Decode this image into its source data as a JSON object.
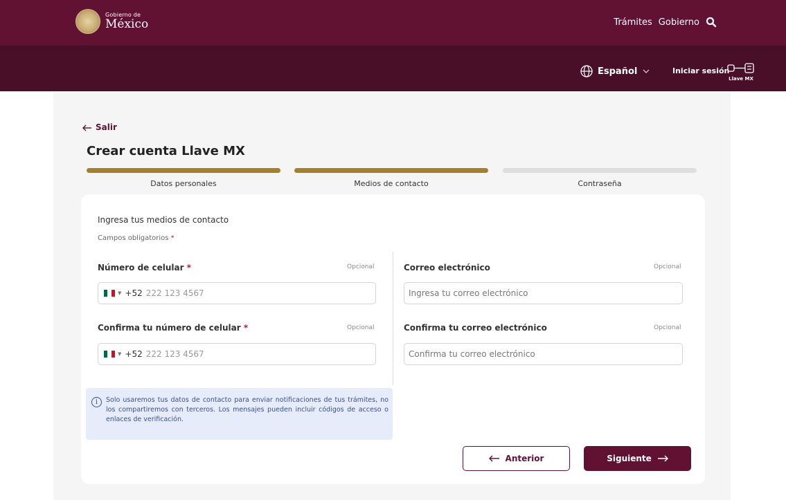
{
  "header": {
    "logo_small": "Gobierno de",
    "logo_big": "México",
    "nav": [
      "Trámites",
      "Gobierno"
    ],
    "language": "Español",
    "login": "Iniciar sesión",
    "llave_label": "Llave MX"
  },
  "page": {
    "back_label": "Salir",
    "title": "Crear cuenta Llave MX"
  },
  "stepper": {
    "steps": [
      {
        "label": "Datos personales",
        "state": "complete"
      },
      {
        "label": "Medios de contacto",
        "state": "current"
      },
      {
        "label": "Contraseña",
        "state": "pending"
      }
    ]
  },
  "form": {
    "intro": "Ingresa tus medios de contacto",
    "required_note": "Campos obligatorios",
    "required_marker": "*",
    "optional_label": "Opcional",
    "phone": {
      "label": "Número de celular",
      "dial_code": "+52",
      "placeholder": "222 123 4567"
    },
    "phone_confirm": {
      "label": "Confirma tu número de celular",
      "dial_code": "+52",
      "placeholder": "222 123 4567"
    },
    "email": {
      "label": "Correo electrónico",
      "placeholder": "Ingresa tu correo electrónico"
    },
    "email_confirm": {
      "label": "Confirma tu correo electrónico",
      "placeholder": "Confirma tu correo electrónico"
    },
    "info": "Solo usaremos tus datos de contacto para enviar notificaciones de tus trámites, no los compartiremos con terceros. Los mensajes pueden incluir códigos de acceso o enlaces de verificación."
  },
  "buttons": {
    "previous": "Anterior",
    "next": "Siguiente"
  },
  "colors": {
    "primary": "#611232",
    "secondary_bar": "#4a0f28",
    "gold": "#a57f2c",
    "step_pending": "#dedede",
    "info_bg": "#e7ecfa",
    "info_text": "#3a4f8f",
    "required": "#9f2241"
  },
  "icons": {
    "seal": "mexico-seal-icon",
    "search": "search-icon",
    "globe": "globe-icon",
    "chevron": "chevron-down-icon",
    "key": "key-icon",
    "back_arrow": "arrow-left-icon",
    "info": "info-icon",
    "flag": "mexico-flag-icon",
    "next_arrow": "arrow-right-icon"
  }
}
